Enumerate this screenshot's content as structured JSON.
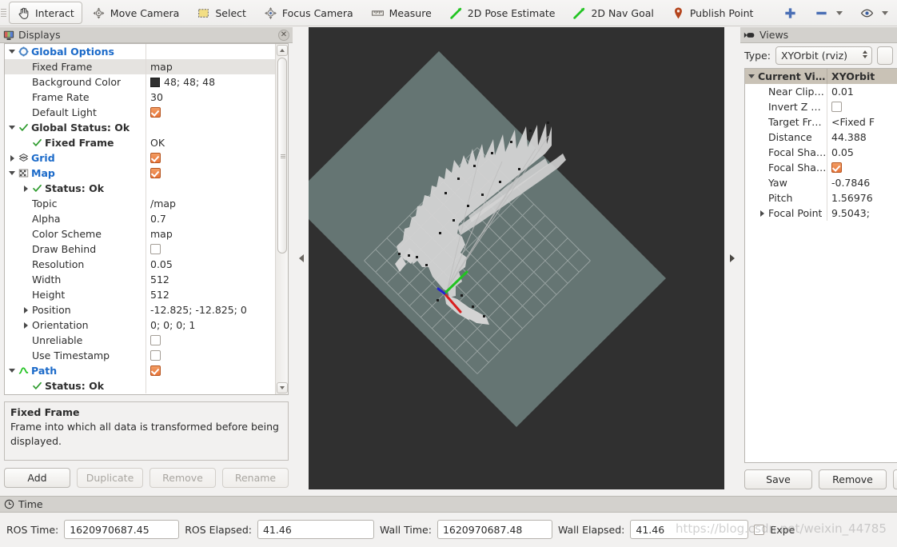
{
  "toolbar": {
    "items": [
      {
        "label": "Interact",
        "icon": "hand-icon",
        "active": true
      },
      {
        "label": "Move Camera",
        "icon": "move-camera-icon",
        "active": false
      },
      {
        "label": "Select",
        "icon": "select-icon",
        "active": false
      },
      {
        "label": "Focus Camera",
        "icon": "focus-camera-icon",
        "active": false
      },
      {
        "label": "Measure",
        "icon": "ruler-icon",
        "active": false
      },
      {
        "label": "2D Pose Estimate",
        "icon": "pose-arrow-icon",
        "active": false
      },
      {
        "label": "2D Nav Goal",
        "icon": "nav-goal-arrow-icon",
        "active": false
      },
      {
        "label": "Publish Point",
        "icon": "map-pin-icon",
        "active": false
      }
    ],
    "add_icon": "plus-icon",
    "remove_icon": "minus-icon",
    "visibility_icon": "eye-icon"
  },
  "displays": {
    "title": "Displays",
    "close_icon": "close-icon",
    "panel_icon": "monitor-icon",
    "rows": [
      {
        "indent": 0,
        "twisty": "down",
        "icon": "gear-icon",
        "label": "Global Options",
        "bold": false,
        "blue": true,
        "value": "",
        "value_type": "none",
        "selected": false
      },
      {
        "indent": 1,
        "twisty": "none",
        "icon": "",
        "label": "Fixed Frame",
        "value": "map",
        "value_type": "text",
        "selected": true
      },
      {
        "indent": 1,
        "twisty": "none",
        "icon": "",
        "label": "Background Color",
        "value": "48; 48; 48",
        "value_type": "color",
        "color": "#303030",
        "selected": false
      },
      {
        "indent": 1,
        "twisty": "none",
        "icon": "",
        "label": "Frame Rate",
        "value": "30",
        "value_type": "text",
        "selected": false
      },
      {
        "indent": 1,
        "twisty": "none",
        "icon": "",
        "label": "Default Light",
        "value": "",
        "value_type": "checked",
        "selected": false
      },
      {
        "indent": 0,
        "twisty": "down",
        "icon": "check-icon",
        "label": "Global Status: Ok",
        "bold": true,
        "value": "",
        "value_type": "none",
        "selected": false
      },
      {
        "indent": 1,
        "twisty": "none",
        "icon": "check-icon",
        "label": "Fixed Frame",
        "bold": true,
        "value": "OK",
        "value_type": "text",
        "selected": false
      },
      {
        "indent": 0,
        "twisty": "right",
        "icon": "grid-icon",
        "label": "Grid",
        "blue": true,
        "value": "",
        "value_type": "checked",
        "selected": false
      },
      {
        "indent": 0,
        "twisty": "down",
        "icon": "map-icon",
        "label": "Map",
        "blue": true,
        "value": "",
        "value_type": "checked",
        "selected": false
      },
      {
        "indent": 1,
        "twisty": "right",
        "icon": "check-icon",
        "label": "Status: Ok",
        "bold": true,
        "value": "",
        "value_type": "none",
        "selected": false
      },
      {
        "indent": 1,
        "twisty": "none",
        "icon": "",
        "label": "Topic",
        "value": "/map",
        "value_type": "text",
        "selected": false
      },
      {
        "indent": 1,
        "twisty": "none",
        "icon": "",
        "label": "Alpha",
        "value": "0.7",
        "value_type": "text",
        "selected": false
      },
      {
        "indent": 1,
        "twisty": "none",
        "icon": "",
        "label": "Color Scheme",
        "value": "map",
        "value_type": "text",
        "selected": false
      },
      {
        "indent": 1,
        "twisty": "none",
        "icon": "",
        "label": "Draw Behind",
        "value": "",
        "value_type": "unchecked",
        "selected": false
      },
      {
        "indent": 1,
        "twisty": "none",
        "icon": "",
        "label": "Resolution",
        "value": "0.05",
        "value_type": "text",
        "selected": false
      },
      {
        "indent": 1,
        "twisty": "none",
        "icon": "",
        "label": "Width",
        "value": "512",
        "value_type": "text",
        "selected": false
      },
      {
        "indent": 1,
        "twisty": "none",
        "icon": "",
        "label": "Height",
        "value": "512",
        "value_type": "text",
        "selected": false
      },
      {
        "indent": 1,
        "twisty": "right",
        "icon": "",
        "label": "Position",
        "value": "-12.825; -12.825; 0",
        "value_type": "text",
        "selected": false
      },
      {
        "indent": 1,
        "twisty": "right",
        "icon": "",
        "label": "Orientation",
        "value": "0; 0; 0; 1",
        "value_type": "text",
        "selected": false
      },
      {
        "indent": 1,
        "twisty": "none",
        "icon": "",
        "label": "Unreliable",
        "value": "",
        "value_type": "unchecked",
        "selected": false
      },
      {
        "indent": 1,
        "twisty": "none",
        "icon": "",
        "label": "Use Timestamp",
        "value": "",
        "value_type": "unchecked",
        "selected": false
      },
      {
        "indent": 0,
        "twisty": "down",
        "icon": "path-icon",
        "label": "Path",
        "blue": true,
        "value": "",
        "value_type": "checked",
        "selected": false
      },
      {
        "indent": 1,
        "twisty": "none",
        "icon": "check-icon",
        "label": "Status: Ok",
        "bold": true,
        "value": "",
        "value_type": "none",
        "selected": false
      }
    ],
    "description": {
      "title": "Fixed Frame",
      "text": "Frame into which all data is transformed before being displayed."
    },
    "buttons": [
      {
        "label": "Add",
        "enabled": true
      },
      {
        "label": "Duplicate",
        "enabled": false
      },
      {
        "label": "Remove",
        "enabled": false
      },
      {
        "label": "Rename",
        "enabled": false
      }
    ]
  },
  "views": {
    "title": "Views",
    "panel_icon": "camera-icon",
    "type_label": "Type:",
    "type_value": "XYOrbit (rviz)",
    "header": {
      "name": "Current View",
      "value": "XYOrbit"
    },
    "rows": [
      {
        "twisty": "none",
        "label": "Near Clip ...",
        "value": "0.01",
        "value_type": "text"
      },
      {
        "twisty": "none",
        "label": "Invert Z Axis",
        "value": "",
        "value_type": "unchecked"
      },
      {
        "twisty": "none",
        "label": "Target Fra...",
        "value": "<Fixed F",
        "value_type": "text"
      },
      {
        "twisty": "none",
        "label": "Distance",
        "value": "44.388",
        "value_type": "text"
      },
      {
        "twisty": "none",
        "label": "Focal Shap...",
        "value": "0.05",
        "value_type": "text"
      },
      {
        "twisty": "none",
        "label": "Focal Shap...",
        "value": "",
        "value_type": "checked"
      },
      {
        "twisty": "none",
        "label": "Yaw",
        "value": "-0.7846",
        "value_type": "text"
      },
      {
        "twisty": "none",
        "label": "Pitch",
        "value": "1.56976",
        "value_type": "text"
      },
      {
        "twisty": "right",
        "label": "Focal Point",
        "value": "9.5043; ",
        "value_type": "text"
      }
    ],
    "buttons": [
      {
        "label": "Save",
        "enabled": true
      },
      {
        "label": "Remove",
        "enabled": true
      },
      {
        "label": "",
        "enabled": true
      }
    ]
  },
  "viewport": {
    "background_color": "#303030",
    "map_color": "#657573",
    "grid_color": "#c8cccb",
    "scan_color": "#d2d2d2",
    "axis_x_color": "#d81f1f",
    "axis_y_color": "#1fbf1f",
    "axis_z_color": "#2222cc"
  },
  "time": {
    "title": "Time",
    "panel_icon": "clock-icon",
    "fields": [
      {
        "label": "ROS Time:",
        "value": "1620970687.45"
      },
      {
        "label": "ROS Elapsed:",
        "value": "41.46"
      },
      {
        "label": "Wall Time:",
        "value": "1620970687.48"
      },
      {
        "label": "Wall Elapsed:",
        "value": "41.46"
      }
    ],
    "experimental_label": "Expe"
  },
  "watermark": "https://blog.csdn.net/weixin_44785"
}
